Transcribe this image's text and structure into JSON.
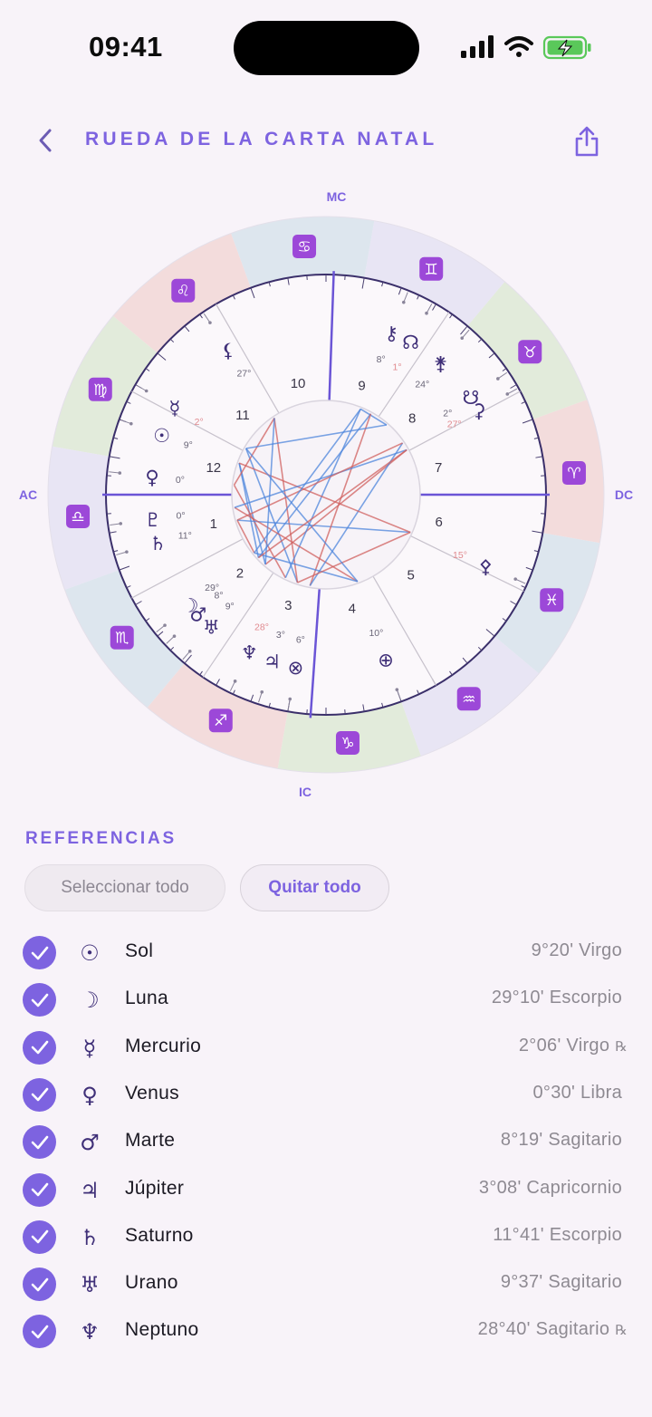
{
  "status": {
    "time": "09:41"
  },
  "header": {
    "title": "RUEDA DE LA CARTA NATAL"
  },
  "chart": {
    "angles": {
      "mc": "MC",
      "ic": "IC",
      "ac": "AC",
      "dc": "DC"
    },
    "signs": [
      "♈",
      "♉",
      "♊",
      "♋",
      "♌",
      "♍",
      "♎",
      "♏",
      "♐",
      "♑",
      "♒",
      "♓"
    ],
    "houses": [
      "1",
      "2",
      "3",
      "4",
      "5",
      "6",
      "7",
      "8",
      "9",
      "10",
      "11",
      "12"
    ],
    "planets": [
      {
        "glyph": "☉",
        "deg": "9°",
        "retro": false
      },
      {
        "glyph": "☽",
        "deg": "29°",
        "retro": false
      },
      {
        "glyph": "☿",
        "deg": "2°",
        "retro": true
      },
      {
        "glyph": "♀",
        "deg": "0°",
        "retro": false
      },
      {
        "glyph": "♂",
        "deg": "8°",
        "retro": false
      },
      {
        "glyph": "♃",
        "deg": "3°",
        "retro": false
      },
      {
        "glyph": "♄",
        "deg": "11°",
        "retro": false
      },
      {
        "glyph": "♅",
        "deg": "9°",
        "retro": false
      },
      {
        "glyph": "♆",
        "deg": "28°",
        "retro": true
      },
      {
        "glyph": "♇",
        "deg": "0°",
        "retro": false
      },
      {
        "glyph": "⚷",
        "deg": "8°",
        "retro": false
      },
      {
        "glyph": "☊",
        "deg": "1°",
        "retro": true
      },
      {
        "glyph": "⊗",
        "deg": "6°",
        "retro": false
      },
      {
        "glyph": "⚸",
        "deg": "27°",
        "retro": false
      },
      {
        "glyph": "⚵",
        "deg": "24°",
        "retro": false
      },
      {
        "glyph": "⚴",
        "deg": "15°",
        "retro": true
      },
      {
        "glyph": "⊕",
        "deg": "10°",
        "retro": false
      },
      {
        "glyph": "⚳",
        "deg": "27°",
        "retro": true
      },
      {
        "glyph": "☋",
        "deg": "2°",
        "retro": false
      }
    ],
    "colors": {
      "accent": "#7d63e0",
      "glyph": "#3f2f78",
      "fire": "#f3dcdc",
      "earth": "#e2ebdb",
      "air": "#e8e5f4",
      "water": "#dde6ee",
      "harmonic": "#4d86dc",
      "tense": "#d0605f"
    }
  },
  "legend": {
    "title": "REFERENCIAS",
    "select_all": "Seleccionar todo",
    "clear_all": "Quitar todo",
    "items": [
      {
        "glyph": "☉",
        "name": "Sol",
        "position": "9°20' Virgo",
        "retro": ""
      },
      {
        "glyph": "☽",
        "name": "Luna",
        "position": "29°10' Escorpio",
        "retro": ""
      },
      {
        "glyph": "☿",
        "name": "Mercurio",
        "position": "2°06' Virgo",
        "retro": "℞"
      },
      {
        "glyph": "♀",
        "name": "Venus",
        "position": "0°30' Libra",
        "retro": ""
      },
      {
        "glyph": "♂",
        "name": "Marte",
        "position": "8°19' Sagitario",
        "retro": ""
      },
      {
        "glyph": "♃",
        "name": "Júpiter",
        "position": "3°08' Capricornio",
        "retro": ""
      },
      {
        "glyph": "♄",
        "name": "Saturno",
        "position": "11°41' Escorpio",
        "retro": ""
      },
      {
        "glyph": "♅",
        "name": "Urano",
        "position": "9°37' Sagitario",
        "retro": ""
      },
      {
        "glyph": "♆",
        "name": "Neptuno",
        "position": "28°40' Sagitario",
        "retro": "℞"
      }
    ]
  }
}
